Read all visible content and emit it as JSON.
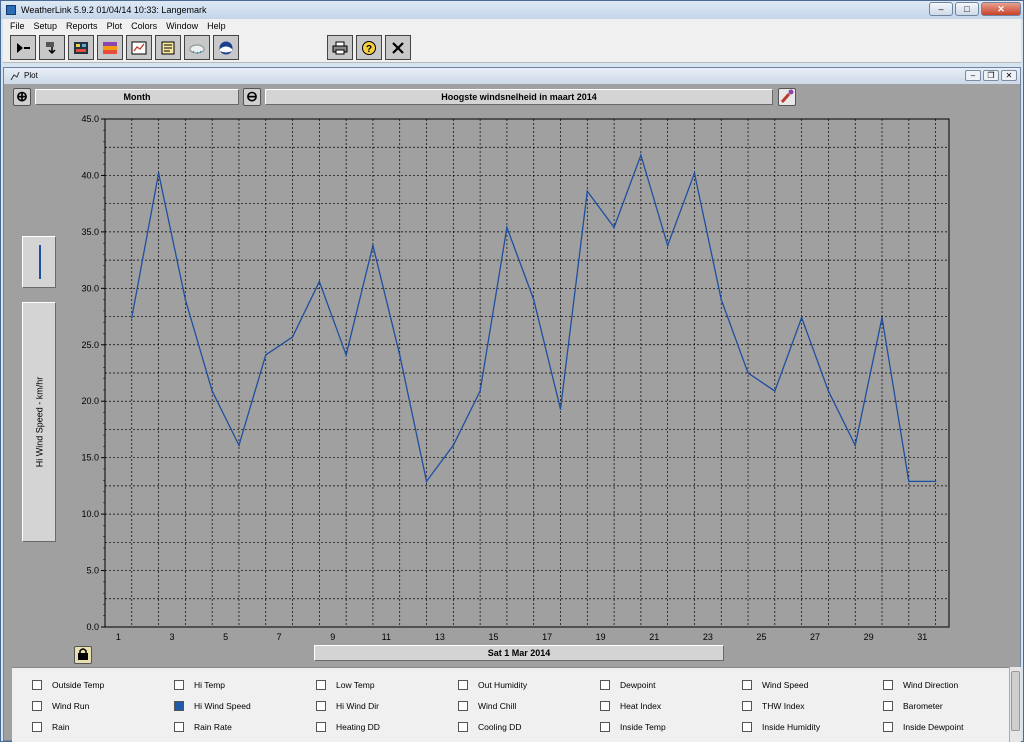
{
  "app": {
    "title": "WeatherLink 5.9.2  01/04/14  10:33: Langemark",
    "icon": "weatherlink-app-icon"
  },
  "menu": [
    "File",
    "Setup",
    "Reports",
    "Plot",
    "Colors",
    "Window",
    "Help"
  ],
  "toolbar": {
    "buttons": [
      {
        "name": "connect-icon"
      },
      {
        "name": "download-icon"
      },
      {
        "name": "bulletin-icon"
      },
      {
        "name": "strip-chart-icon"
      },
      {
        "name": "plot-icon"
      },
      {
        "name": "noaa-summary-icon"
      },
      {
        "name": "weather-cloud-icon"
      },
      {
        "name": "noaa-logo-icon"
      },
      {
        "name": "print-icon"
      },
      {
        "name": "help-icon"
      },
      {
        "name": "close-icon"
      }
    ]
  },
  "plot_window": {
    "title": "Plot",
    "span_field": "Month",
    "plot_title": "Hoogste windsnelheid in maart 2014",
    "y_axis_label": "Hi Wind Speed - km/hr",
    "date_field": "Sat 1 Mar 2014",
    "line_color": "#1f4fa0"
  },
  "chart_data": {
    "type": "line",
    "title": "Hoogste windsnelheid in maart 2014",
    "xlabel": "",
    "ylabel": "Hi Wind Speed - km/hr",
    "ylim": [
      0,
      45
    ],
    "xlim": [
      0.5,
      32
    ],
    "grid": true,
    "y_ticks": [
      "0.0",
      "5.0",
      "10.0",
      "15.0",
      "20.0",
      "25.0",
      "30.0",
      "35.0",
      "40.0",
      "45.0"
    ],
    "x_ticks": [
      "1",
      "3",
      "5",
      "7",
      "9",
      "11",
      "13",
      "15",
      "17",
      "19",
      "21",
      "23",
      "25",
      "27",
      "29",
      "31"
    ],
    "series": [
      {
        "x": [
          1.5,
          2.5,
          3.5,
          4.5,
          5.5,
          6.5,
          7.5,
          8.5,
          9.5,
          10.5,
          11.5,
          12.5,
          13.5,
          14.5,
          15.5,
          16.5,
          17.5,
          18.5,
          19.5,
          20.5,
          21.5,
          22.5,
          23.5,
          24.5,
          25.5,
          26.5,
          27.5,
          28.5,
          29.5,
          30.5,
          31.5
        ],
        "values": [
          27.4,
          40.2,
          29.0,
          20.9,
          16.1,
          24.1,
          25.7,
          30.6,
          24.1,
          33.8,
          24.1,
          12.9,
          16.1,
          20.9,
          35.4,
          29.0,
          19.3,
          38.6,
          35.4,
          41.8,
          33.8,
          40.2,
          29.0,
          22.5,
          20.9,
          27.4,
          20.9,
          16.1,
          27.4,
          12.9,
          12.9
        ]
      }
    ]
  },
  "legend": {
    "items": [
      {
        "label": "Outside Temp",
        "checked": false
      },
      {
        "label": "Hi Temp",
        "checked": false
      },
      {
        "label": "Low Temp",
        "checked": false
      },
      {
        "label": "Out Humidity",
        "checked": false
      },
      {
        "label": "Dewpoint",
        "checked": false
      },
      {
        "label": "Wind Speed",
        "checked": false
      },
      {
        "label": "Wind Direction",
        "checked": false
      },
      {
        "label": "Wind Run",
        "checked": false
      },
      {
        "label": "Hi Wind Speed",
        "checked": true
      },
      {
        "label": "Hi Wind Dir",
        "checked": false
      },
      {
        "label": "Wind Chill",
        "checked": false
      },
      {
        "label": "Heat Index",
        "checked": false
      },
      {
        "label": "THW Index",
        "checked": false
      },
      {
        "label": "Barometer",
        "checked": false
      },
      {
        "label": "Rain",
        "checked": false
      },
      {
        "label": "Rain Rate",
        "checked": false
      },
      {
        "label": "Heating DD",
        "checked": false
      },
      {
        "label": "Cooling DD",
        "checked": false
      },
      {
        "label": "Inside Temp",
        "checked": false
      },
      {
        "label": "Inside Humidity",
        "checked": false
      },
      {
        "label": "Inside Dewpoint",
        "checked": false
      }
    ]
  }
}
